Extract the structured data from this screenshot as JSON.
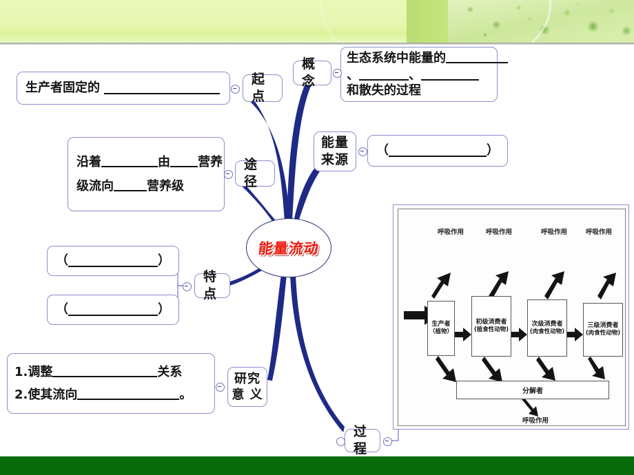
{
  "slide": {
    "title": "能量流动",
    "banner": {
      "accent_green": "#b9dd72",
      "light_green": "#eaf8b8"
    },
    "footer": {
      "color": "#0a6b0a"
    }
  },
  "mindmap": {
    "center": {
      "label": "能量流动",
      "color": "#ee1c10"
    },
    "branches": [
      {
        "key": "qidian",
        "label": "起点",
        "detail": {
          "prefix": "生产者固定的",
          "blank_width": 168,
          "suffix": ""
        }
      },
      {
        "key": "gainian",
        "label": "概念",
        "detail": {
          "line1_prefix": "生态系统中能量的",
          "line1_blank": 90,
          "line2_prefix": "、",
          "line2_blank_a": 72,
          "line2_mid": "、",
          "line2_blank_b": 82,
          "line3": "和散失的过程"
        }
      },
      {
        "key": "tujing",
        "label": "途径",
        "detail": {
          "l1a": "沿着",
          "l1b": "由",
          "l1c": "营养",
          "l2a": "级流向",
          "l2b": "营养级",
          "blank1": 82,
          "blank2": 40,
          "blank3": 48
        }
      },
      {
        "key": "nengliang-laiyuan",
        "label": "能量\n来源",
        "detail": {
          "open_paren": "（",
          "blank_width": 150,
          "close_paren": "）"
        }
      },
      {
        "key": "tedian",
        "label": "特点",
        "details": [
          {
            "open_paren": "（",
            "blank_width": 150,
            "close_paren": "）"
          },
          {
            "open_paren": "（",
            "blank_width": 150,
            "close_paren": "）"
          }
        ]
      },
      {
        "key": "yanjiu-yiyi",
        "label": "研究\n意 义",
        "detail": {
          "item1_prefix": "1.调整",
          "item1_blank": 168,
          "item1_suffix": "关系",
          "item2_prefix": "2.使其流向",
          "item2_blank": 178,
          "item2_suffix": "。"
        }
      },
      {
        "key": "guocheng",
        "label": "过程"
      }
    ]
  },
  "process_figure": {
    "respiration_labels": [
      "呼吸作用",
      "呼吸作用",
      "呼吸作用",
      "呼吸作用"
    ],
    "trophic_boxes": [
      {
        "line1": "生产者",
        "line2": "（植物）"
      },
      {
        "line1": "初级消费者",
        "line2": "(植食性动物)"
      },
      {
        "line1": "次级消费者",
        "line2": "(肉食性动物)"
      },
      {
        "line1": "三级消费者",
        "line2": "(肉食性动物)"
      }
    ],
    "decomposer": "分解者",
    "decomposer_respiration": "呼吸作用"
  }
}
